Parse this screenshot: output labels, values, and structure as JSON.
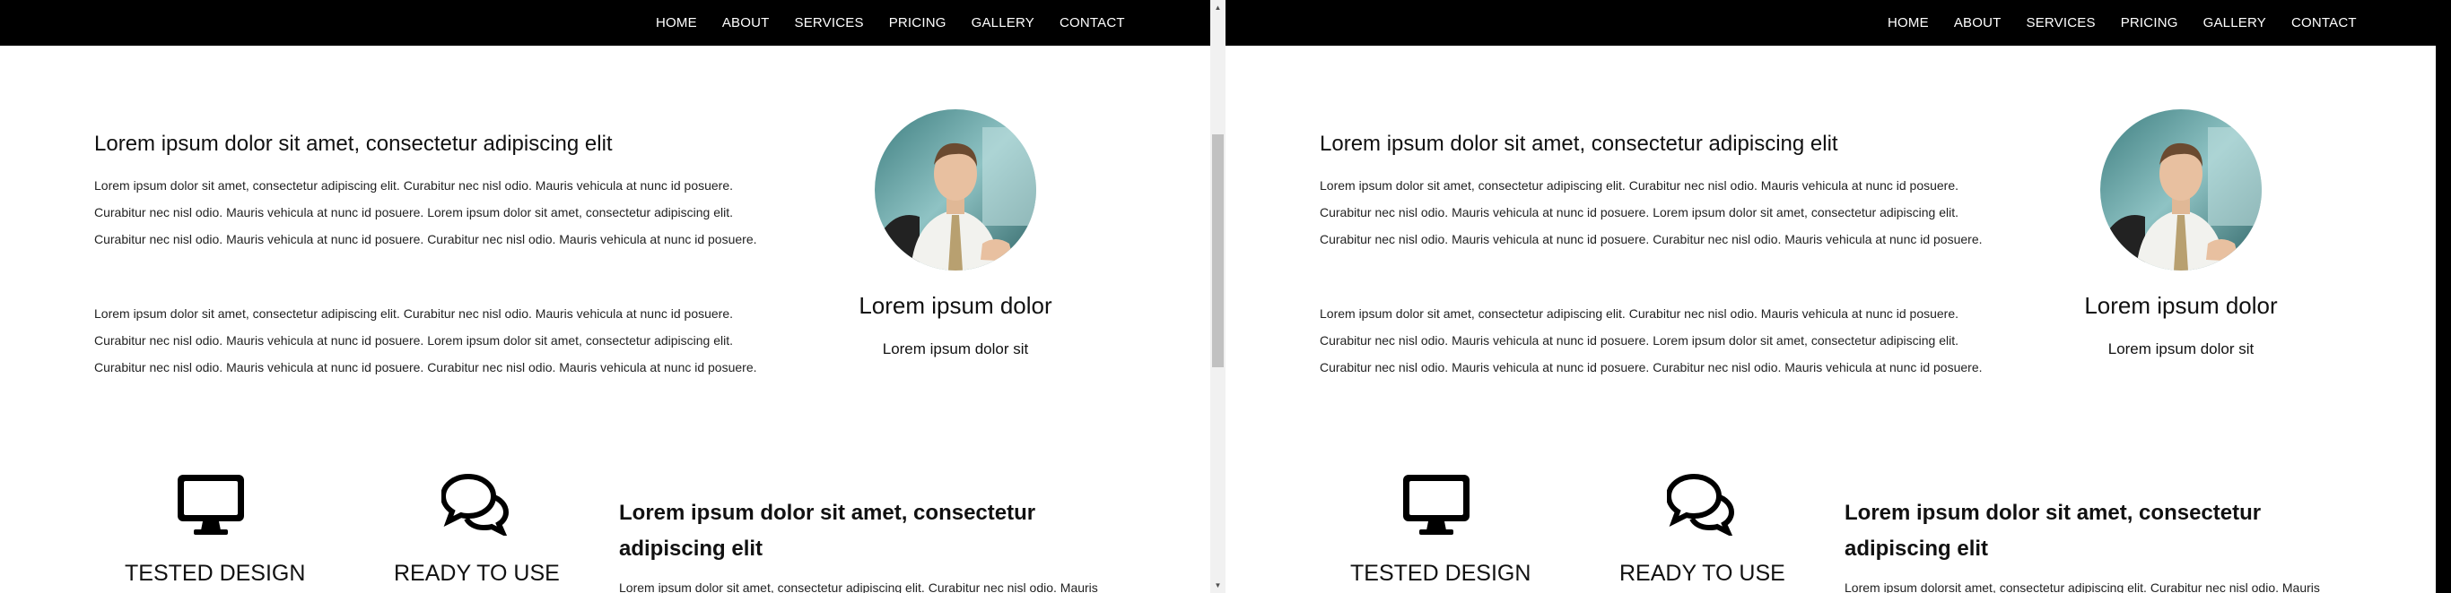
{
  "nav": {
    "items": [
      "HOME",
      "ABOUT",
      "SERVICES",
      "PRICING",
      "GALLERY",
      "CONTACT"
    ]
  },
  "about": {
    "heading": "Lorem ipsum dolor sit amet, consectetur adipiscing elit",
    "paragraph1": "Lorem ipsum dolor sit amet, consectetur adipiscing elit. Curabitur nec nisl odio. Mauris vehicula at nunc id posuere. Curabitur nec nisl odio. Mauris vehicula at nunc id posuere. Lorem ipsum dolor sit amet, consectetur adipiscing elit. Curabitur nec nisl odio. Mauris vehicula at nunc id posuere. Curabitur nec nisl odio. Mauris vehicula at nunc id posuere.",
    "paragraph2": "Lorem ipsum dolor sit amet, consectetur adipiscing elit. Curabitur nec nisl odio. Mauris vehicula at nunc id posuere. Curabitur nec nisl odio. Mauris vehicula at nunc id posuere. Lorem ipsum dolor sit amet, consectetur adipiscing elit. Curabitur nec nisl odio. Mauris vehicula at nunc id posuere. Curabitur nec nisl odio. Mauris vehicula at nunc id posuere."
  },
  "profile": {
    "name": "Lorem ipsum dolor",
    "subtitle": "Lorem ipsum dolor sit"
  },
  "features": {
    "items": [
      {
        "label": "TESTED DESIGN",
        "icon": "monitor-icon"
      },
      {
        "label": "READY TO USE",
        "icon": "chat-bubbles-icon"
      }
    ],
    "heading": "Lorem ipsum dolor sit amet, consectetur adipiscing elit",
    "text_left": "Lorem ipsum dolor sit amet, consectetur adipiscing elit. Curabitur nec nisl odio. Mauris",
    "text_right": "Lorem ipsum dolorsit amet, consectetur adipiscing elit. Curabitur nec nisl odio. Mauris"
  },
  "colors": {
    "navbar": "#000000",
    "background": "#ffffff",
    "scroll_track": "#f1f1f1",
    "scroll_thumb": "#c1c1c1"
  },
  "scrollbar": {
    "position_fraction": 0.25
  }
}
